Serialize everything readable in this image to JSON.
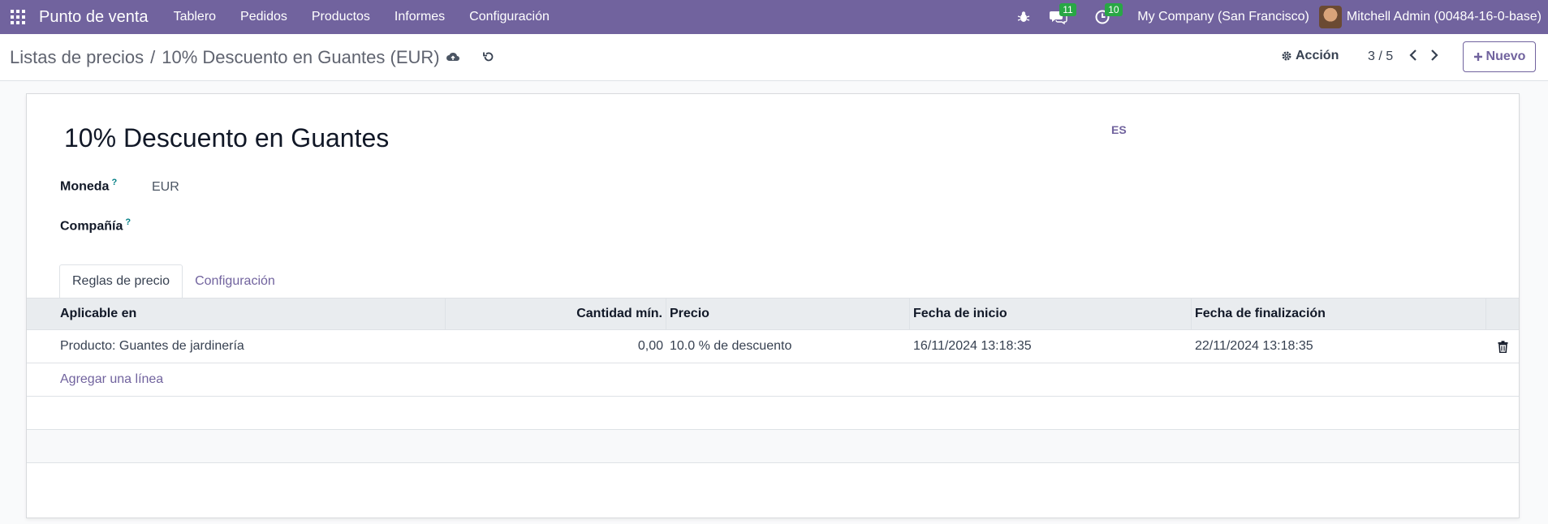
{
  "navbar": {
    "app_name": "Punto de venta",
    "menu": [
      "Tablero",
      "Pedidos",
      "Productos",
      "Informes",
      "Configuración"
    ],
    "messages_count": "11",
    "activities_count": "10",
    "company": "My Company (San Francisco)",
    "user": "Mitchell Admin (00484-16-0-base)"
  },
  "control_panel": {
    "breadcrumb_parent": "Listas de precios",
    "breadcrumb_separator": "/",
    "breadcrumb_current": "10% Descuento en Guantes (EUR)",
    "action_label": "Acción",
    "pager": "3 / 5",
    "new_label": "Nuevo"
  },
  "form": {
    "title": "10% Descuento en Guantes",
    "lang": "ES",
    "currency_label": "Moneda",
    "currency_value": "EUR",
    "company_label": "Compañía",
    "help_mark": "?",
    "tabs": [
      "Reglas de precio",
      "Configuración"
    ],
    "table": {
      "headers": [
        "Aplicable en",
        "Cantidad mín.",
        "Precio",
        "Fecha de inicio",
        "Fecha de finalización"
      ],
      "rows": [
        {
          "applicable": "Producto: Guantes de jardinería",
          "min_qty": "0,00",
          "price": "10.0 % de descuento",
          "start": "16/11/2024 13:18:35",
          "end": "22/11/2024 13:18:35"
        }
      ],
      "add_line": "Agregar una línea"
    }
  },
  "colors": {
    "brand": "#71639e",
    "badge": "#28a745"
  }
}
